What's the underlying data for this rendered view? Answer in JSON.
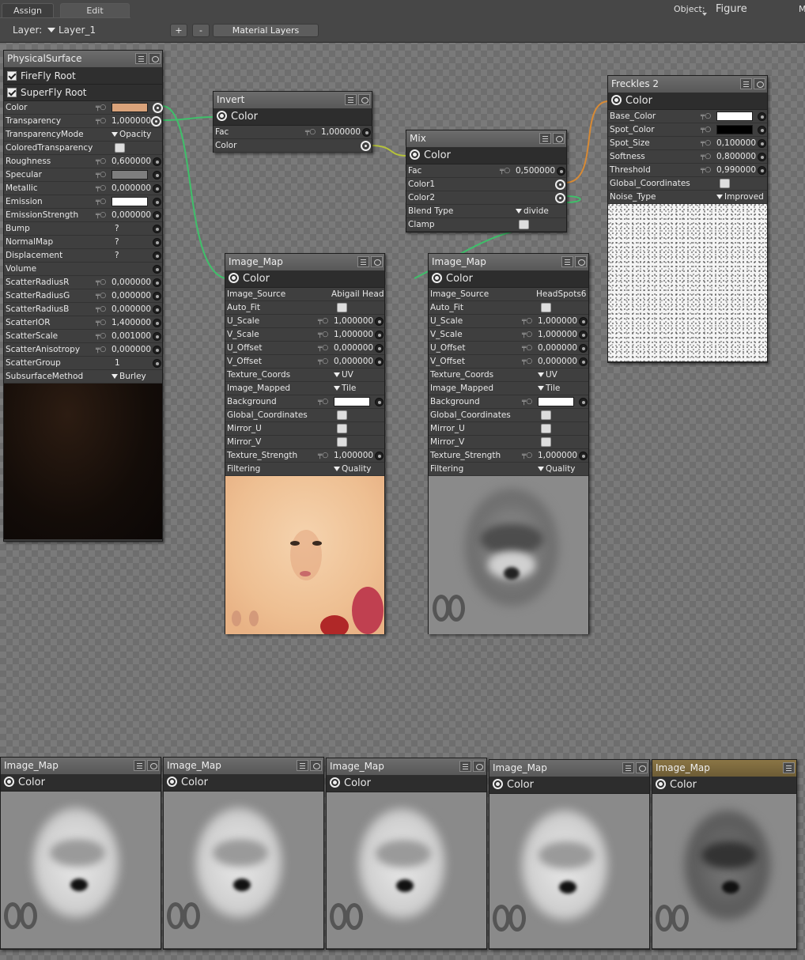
{
  "toolbar": {
    "tabs": [
      "Assign",
      "Edit"
    ],
    "object_label": "Object:",
    "object_value": "Figure",
    "m_label": "M",
    "layer_label": "Layer:",
    "layer_value": "Layer_1",
    "plus": "+",
    "minus": "-",
    "material_layers": "Material Layers"
  },
  "physical": {
    "title": "PhysicalSurface",
    "roots": [
      "FireFly Root",
      "SuperFly Root"
    ],
    "rows": [
      {
        "name": "Color",
        "value": "",
        "swatch": "#d9a27a"
      },
      {
        "name": "Transparency",
        "value": "1,000000"
      },
      {
        "name": "TransparencyMode",
        "value": "Opacity"
      },
      {
        "name": "ColoredTransparency",
        "value": ""
      },
      {
        "name": "Roughness",
        "value": "0,600000"
      },
      {
        "name": "Specular",
        "value": "",
        "swatch": "#7e7e7e"
      },
      {
        "name": "Metallic",
        "value": "0,000000"
      },
      {
        "name": "Emission",
        "value": "",
        "swatch": "#ffffff"
      },
      {
        "name": "EmissionStrength",
        "value": "0,000000"
      },
      {
        "name": "Bump",
        "value": "?"
      },
      {
        "name": "NormalMap",
        "value": "?"
      },
      {
        "name": "Displacement",
        "value": "?"
      },
      {
        "name": "Volume",
        "value": ""
      },
      {
        "name": "ScatterRadiusR",
        "value": "0,000000"
      },
      {
        "name": "ScatterRadiusG",
        "value": "0,000000"
      },
      {
        "name": "ScatterRadiusB",
        "value": "0,000000"
      },
      {
        "name": "ScatterIOR",
        "value": "1,400000"
      },
      {
        "name": "ScatterScale",
        "value": "0,001000"
      },
      {
        "name": "ScatterAnisotropy",
        "value": "0,000000"
      },
      {
        "name": "ScatterGroup",
        "value": "1"
      },
      {
        "name": "SubsurfaceMethod",
        "value": "Burley"
      }
    ]
  },
  "invert": {
    "title": "Invert",
    "output": "Color",
    "rows": [
      {
        "name": "Fac",
        "value": "1,000000"
      },
      {
        "name": "Color",
        "value": ""
      }
    ]
  },
  "mix": {
    "title": "Mix",
    "output": "Color",
    "rows": [
      {
        "name": "Fac",
        "value": "0,500000"
      },
      {
        "name": "Color1",
        "value": ""
      },
      {
        "name": "Color2",
        "value": ""
      },
      {
        "name": "Blend Type",
        "value": "divide"
      },
      {
        "name": "Clamp",
        "value": ""
      }
    ]
  },
  "freckles": {
    "title": "Freckles 2",
    "output": "Color",
    "rows": [
      {
        "name": "Base_Color",
        "value": "",
        "swatch": "#ffffff"
      },
      {
        "name": "Spot_Color",
        "value": "",
        "swatch": "#000000"
      },
      {
        "name": "Spot_Size",
        "value": "0,100000"
      },
      {
        "name": "Softness",
        "value": "0,800000"
      },
      {
        "name": "Threshold",
        "value": "0,990000"
      },
      {
        "name": "Global_Coordinates",
        "value": ""
      },
      {
        "name": "Noise_Type",
        "value": "Improved"
      }
    ]
  },
  "imgA": {
    "title": "Image_Map",
    "output": "Color",
    "rows": [
      {
        "name": "Image_Source",
        "value": "Abigail Head"
      },
      {
        "name": "Auto_Fit",
        "value": ""
      },
      {
        "name": "U_Scale",
        "value": "1,000000"
      },
      {
        "name": "V_Scale",
        "value": "1,000000"
      },
      {
        "name": "U_Offset",
        "value": "0,000000"
      },
      {
        "name": "V_Offset",
        "value": "0,000000"
      },
      {
        "name": "Texture_Coords",
        "value": "UV"
      },
      {
        "name": "Image_Mapped",
        "value": "Tile"
      },
      {
        "name": "Background",
        "value": "",
        "swatch": "#ffffff"
      },
      {
        "name": "Global_Coordinates",
        "value": ""
      },
      {
        "name": "Mirror_U",
        "value": ""
      },
      {
        "name": "Mirror_V",
        "value": ""
      },
      {
        "name": "Texture_Strength",
        "value": "1,000000"
      },
      {
        "name": "Filtering",
        "value": "Quality"
      }
    ]
  },
  "imgB": {
    "title": "Image_Map",
    "output": "Color",
    "rows": [
      {
        "name": "Image_Source",
        "value": "HeadSpots6"
      },
      {
        "name": "Auto_Fit",
        "value": ""
      },
      {
        "name": "U_Scale",
        "value": "1,000000"
      },
      {
        "name": "V_Scale",
        "value": "1,000000"
      },
      {
        "name": "U_Offset",
        "value": "0,000000"
      },
      {
        "name": "V_Offset",
        "value": "0,000000"
      },
      {
        "name": "Texture_Coords",
        "value": "UV"
      },
      {
        "name": "Image_Mapped",
        "value": "Tile"
      },
      {
        "name": "Background",
        "value": "",
        "swatch": "#ffffff"
      },
      {
        "name": "Global_Coordinates",
        "value": ""
      },
      {
        "name": "Mirror_U",
        "value": ""
      },
      {
        "name": "Mirror_V",
        "value": ""
      },
      {
        "name": "Texture_Strength",
        "value": "1,000000"
      },
      {
        "name": "Filtering",
        "value": "Quality"
      }
    ]
  },
  "bottom": [
    {
      "title": "Image_Map",
      "output": "Color"
    },
    {
      "title": "Image_Map",
      "output": "Color"
    },
    {
      "title": "Image_Map",
      "output": "Color"
    },
    {
      "title": "Image_Map",
      "output": "Color"
    },
    {
      "title": "Image_Map",
      "output": "Color"
    }
  ],
  "colors": {
    "wire_green": "#3fbf6a",
    "wire_yellow": "#b5c23a",
    "wire_orange": "#d78a35",
    "selected_title": "#8a7545"
  }
}
